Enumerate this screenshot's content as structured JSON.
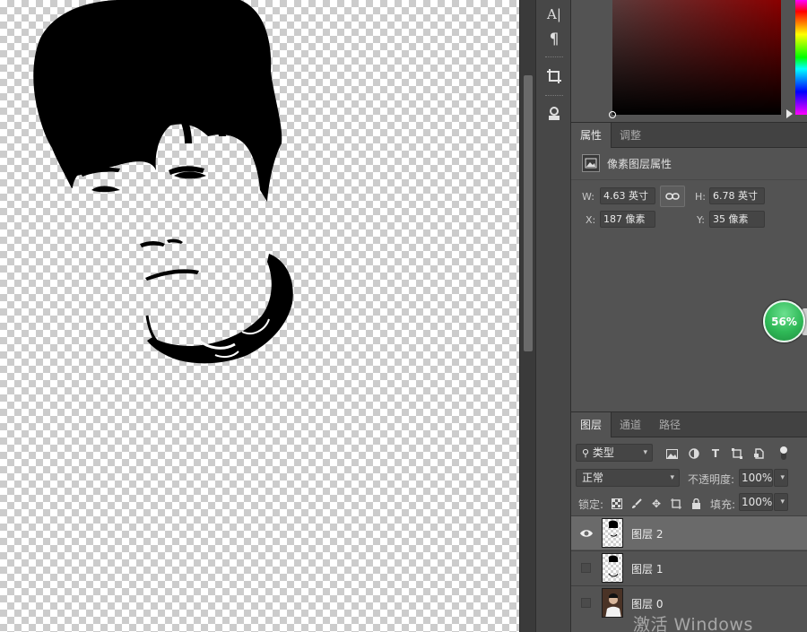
{
  "tools": [
    "type-char-tool",
    "paragraph-tool",
    "crop-tool",
    "stamp-tool"
  ],
  "tool_glyphs": [
    "A|",
    "¶"
  ],
  "properties": {
    "tabs": [
      "属性",
      "调整"
    ],
    "header": "像素图层属性",
    "w_label": "W:",
    "w_value": "4.63 英寸",
    "h_label": "H:",
    "h_value": "6.78 英寸",
    "x_label": "X:",
    "x_value": "187 像素",
    "y_label": "Y:",
    "y_value": "35 像素"
  },
  "zoom_badge": "56%",
  "layers_panel": {
    "tabs": [
      "图层",
      "通道",
      "路径"
    ],
    "filter_label": "类型",
    "blend_mode": "正常",
    "opacity_label": "不透明度:",
    "opacity_value": "100%",
    "lock_label": "锁定:",
    "fill_label": "填充:",
    "fill_value": "100%",
    "layers": [
      {
        "name": "图层 2",
        "visible": true,
        "selected": true
      },
      {
        "name": "图层 1",
        "visible": false,
        "selected": false
      },
      {
        "name": "图层 0",
        "visible": false,
        "selected": false
      }
    ]
  },
  "watermark": "激活 Windows",
  "colors": {
    "panel_bg": "#535353",
    "tab_bar_bg": "#424242",
    "selected_layer": "#6a6a6a",
    "zoom_badge_green": "#2fb957"
  }
}
